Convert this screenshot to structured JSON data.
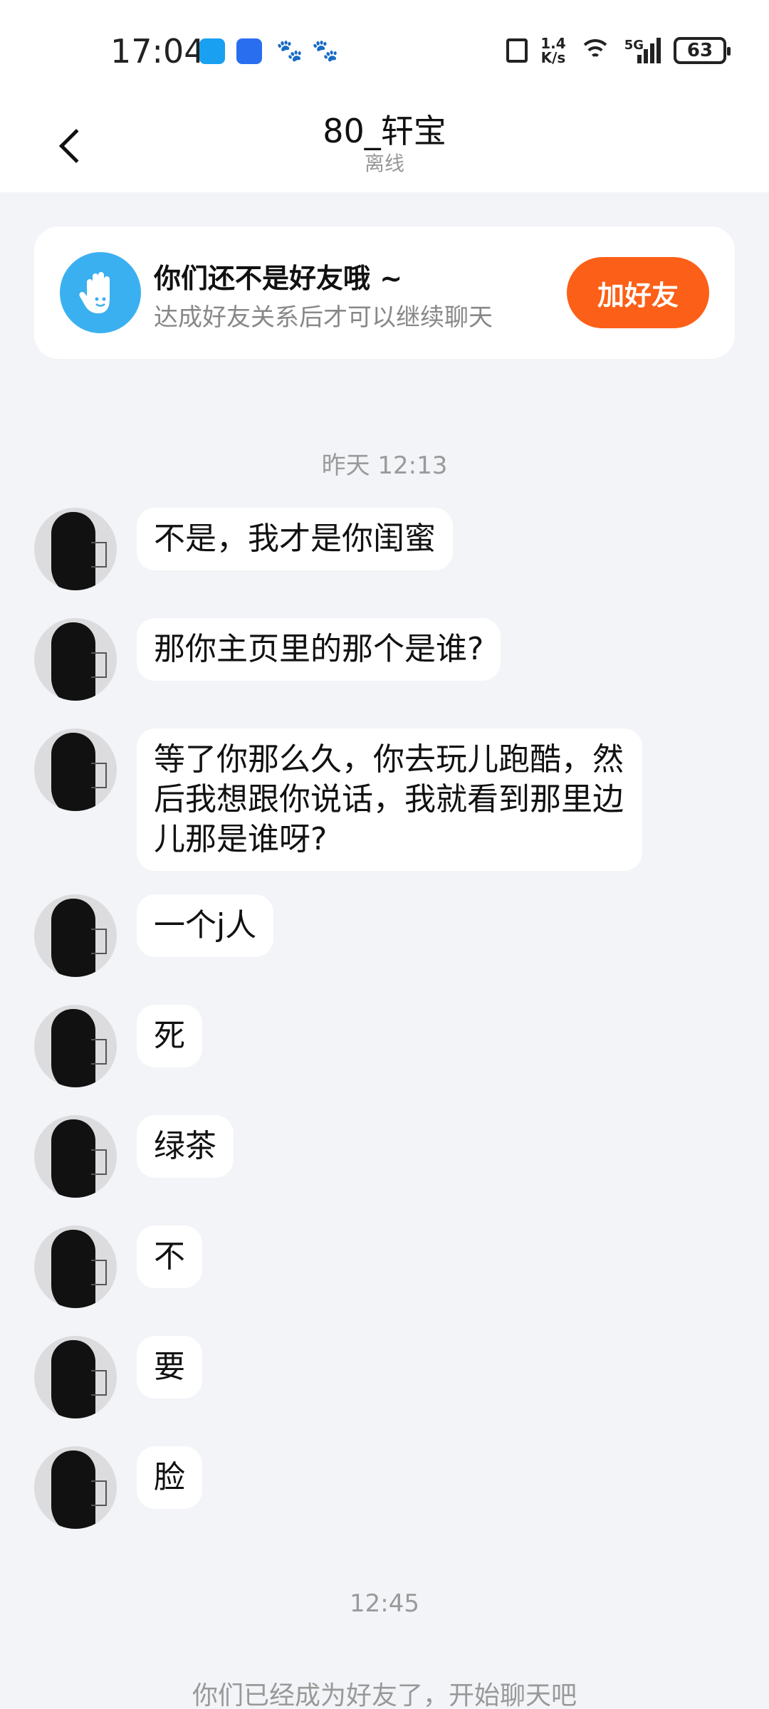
{
  "status_bar": {
    "time": "17:04",
    "network_speed_value": "1.4",
    "network_speed_unit": "K/s",
    "network_type": "5G",
    "battery": "63",
    "icons": [
      "chat-app-icon",
      "shield-app-icon",
      "baidu-paw-icon",
      "baidu-paw-icon",
      "vibrate-icon",
      "wifi-icon",
      "signal-icon",
      "battery-icon"
    ]
  },
  "header": {
    "title": "80_轩宝",
    "status": "离线"
  },
  "friend_card": {
    "title": "你们还不是好友哦 ~",
    "subtitle": "达成好友关系后才可以继续聊天",
    "button_label": "加好友",
    "button_color": "#fc5f17",
    "icon_color": "#3bb0f0"
  },
  "timestamps": {
    "first": "昨天 12:13",
    "second": "12:45"
  },
  "messages": [
    {
      "text": "不是，我才是你闺蜜"
    },
    {
      "text": "那你主页里的那个是谁?"
    },
    {
      "text": "等了你那么久，你去玩儿跑酷，然后我想跟你说话，我就看到那里边儿那是谁呀?"
    },
    {
      "text": "一个j人"
    },
    {
      "text": "死"
    },
    {
      "text": "绿茶"
    },
    {
      "text": "不"
    },
    {
      "text": "要"
    },
    {
      "text": "脸"
    }
  ],
  "footer_note": "你们已经成为好友了，开始聊天吧"
}
